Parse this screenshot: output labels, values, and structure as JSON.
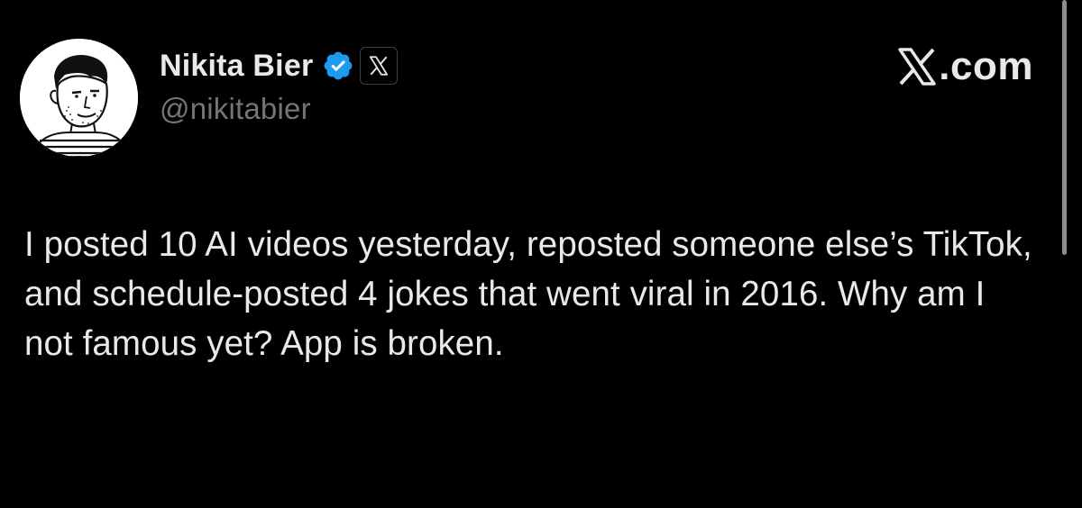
{
  "author": {
    "display_name": "Nikita Bier",
    "handle": "@nikitabier",
    "verified": true,
    "affiliate_badge_icon": "x-logo-icon",
    "avatar_icon": "avatar-sketch-portrait"
  },
  "watermark": {
    "text": ".com",
    "icon": "x-logo-icon"
  },
  "tweet": {
    "text": "I posted 10 AI videos yesterday, reposted someone else’s TikTok, and schedule-posted 4 jokes that went viral in 2016. Why am I not famous yet? App is broken."
  },
  "colors": {
    "background": "#000000",
    "primary_text": "#e7e9ea",
    "secondary_text": "#71767b",
    "verified_blue": "#1d9bf0"
  }
}
